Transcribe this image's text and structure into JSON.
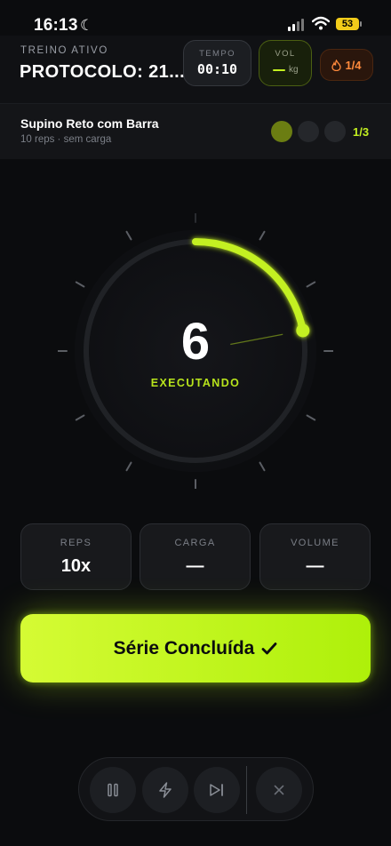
{
  "status_bar": {
    "time": "16:13",
    "battery": "53"
  },
  "header": {
    "label": "TREINO ATIVO",
    "title": "PROTOCOLO: 21...",
    "timer": {
      "label": "TEMPO",
      "value": "00:10"
    },
    "volume": {
      "label": "VOL",
      "unit": "kg"
    },
    "streak": {
      "value": "1/4"
    }
  },
  "exercise": {
    "name": "Supino Reto com Barra",
    "detail": "10 reps · sem carga",
    "set_counter": "1/3",
    "sets_completed_of_total": [
      1,
      3
    ]
  },
  "dial": {
    "rep_count": "6",
    "state": "EXECUTANDO",
    "progress_fraction": 0.22
  },
  "stats": [
    {
      "label": "REPS",
      "value": "10x"
    },
    {
      "label": "CARGA",
      "value": "—"
    },
    {
      "label": "VOLUME",
      "value": "—"
    }
  ],
  "cta": {
    "label": "Série Concluída",
    "icon": "check-icon"
  },
  "controls": [
    "pause-icon",
    "bolt-icon",
    "skip-icon",
    "close-icon"
  ],
  "colors": {
    "accent": "#c3f020",
    "streak": "#ff8a3c",
    "background": "#0b0c0e"
  }
}
